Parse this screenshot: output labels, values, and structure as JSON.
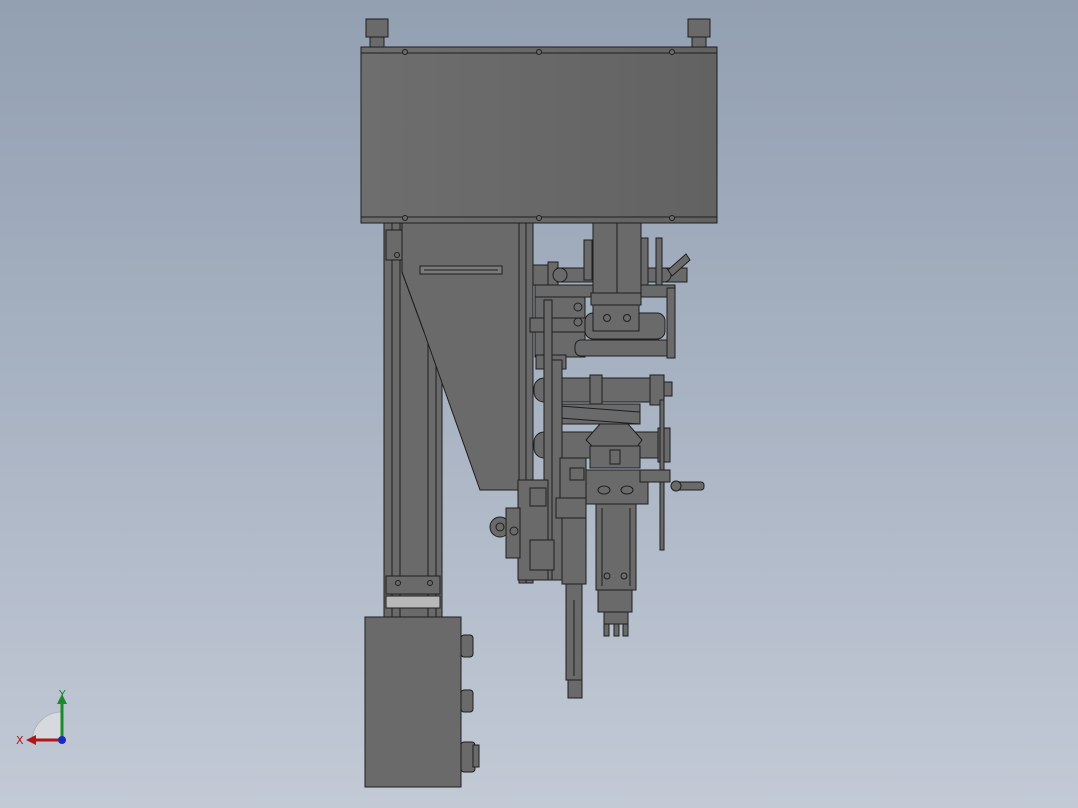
{
  "viewport": {
    "background_top": "#93a0b2",
    "background_bottom": "#c3cad6"
  },
  "model": {
    "body_color": "#6a6a6a",
    "edge_color": "#1e1e1e",
    "highlight_color": "#8c8c8c"
  },
  "triad": {
    "x_label": "X",
    "y_label": "Y",
    "x_color": "#b01818",
    "y_color": "#1a8a2a",
    "z_color": "#1a2ac0"
  }
}
